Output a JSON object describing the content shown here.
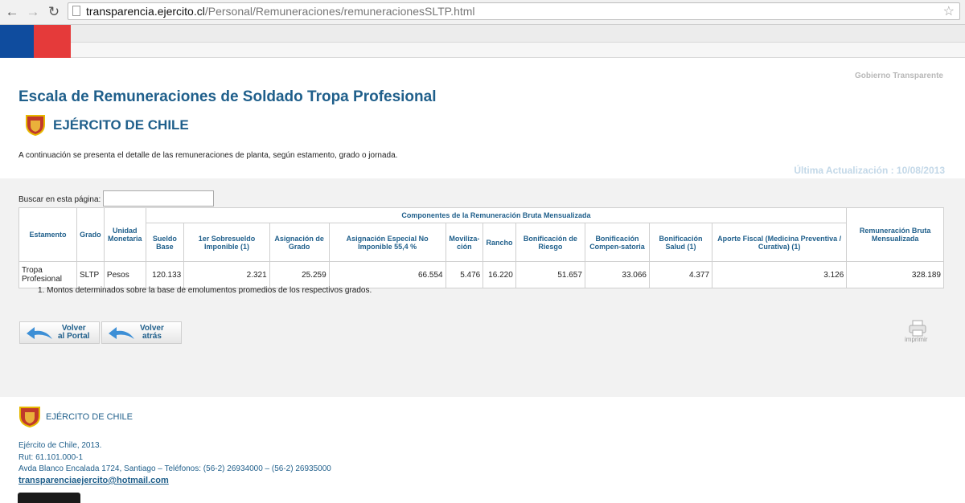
{
  "browser": {
    "url_domain": "transparencia.ejercito.cl",
    "url_path": "/Personal/Remuneraciones/remuneracionesSLTP.html",
    "back_icon": "arrow-left-icon",
    "forward_icon": "arrow-right-icon",
    "reload_icon": "reload-icon",
    "star_icon": "star-icon"
  },
  "header": {
    "gobierno_transparente": "Gobierno Transparente",
    "title": "Escala de Remuneraciones de Soldado Tropa Profesional",
    "org_name": "EJÉRCITO DE CHILE",
    "intro": "A continuación se presenta el detalle de las remuneraciones de planta, según estamento, grado o jornada.",
    "ultima_actualizacion": "Última Actualización : 10/08/2013"
  },
  "search": {
    "label": "Buscar en esta página:",
    "value": ""
  },
  "table": {
    "group_header": "Componentes de la Remuneración Bruta Mensualizada",
    "col_estamento": "Estamento",
    "col_grado": "Grado",
    "col_unidad": "Unidad Monetaria",
    "col_total": "Remuneración Bruta Mensualizada",
    "components": [
      "Sueldo Base",
      "1er Sobresueldo Imponible (1)",
      "Asignación de Grado",
      "Asignación Especial No Imponible 55,4 %",
      "Moviliza-ción",
      "Rancho",
      "Bonificación de Riesgo",
      "Bonificación Compen-satoria",
      "Bonificación Salud (1)",
      "Aporte Fiscal (Medicina Preventiva / Curativa) (1)"
    ],
    "row": {
      "estamento": "Tropa Profesional",
      "grado": "SLTP",
      "unidad": "Pesos",
      "values": [
        "120.133",
        "2.321",
        "25.259",
        "66.554",
        "5.476",
        "16.220",
        "51.657",
        "33.066",
        "4.377",
        "3.126"
      ],
      "total": "328.189"
    }
  },
  "note": "1.  Montos determinados sobre la base de emolumentos promedios de los respectivos grados.",
  "buttons": {
    "volver_portal": [
      "Volver",
      "al Portal"
    ],
    "volver_atras": [
      "Volver",
      "atrás"
    ],
    "imprimir": "imprimir"
  },
  "footer": {
    "org_name": "EJÉRCITO DE CHILE",
    "line1": "Ejército de Chile, 2013.",
    "line2": "Rut: 61.101.000-1",
    "line3": "Avda Blanco Encalada 1724, Santiago – Teléfonos: (56-2) 26934000 – (56-2) 26935000",
    "email": "transparenciaejercito@hotmail.com"
  },
  "colors": {
    "flag_blue": "#0f4c9e",
    "flag_red": "#e53a3a",
    "accent": "#1f5f8b"
  }
}
